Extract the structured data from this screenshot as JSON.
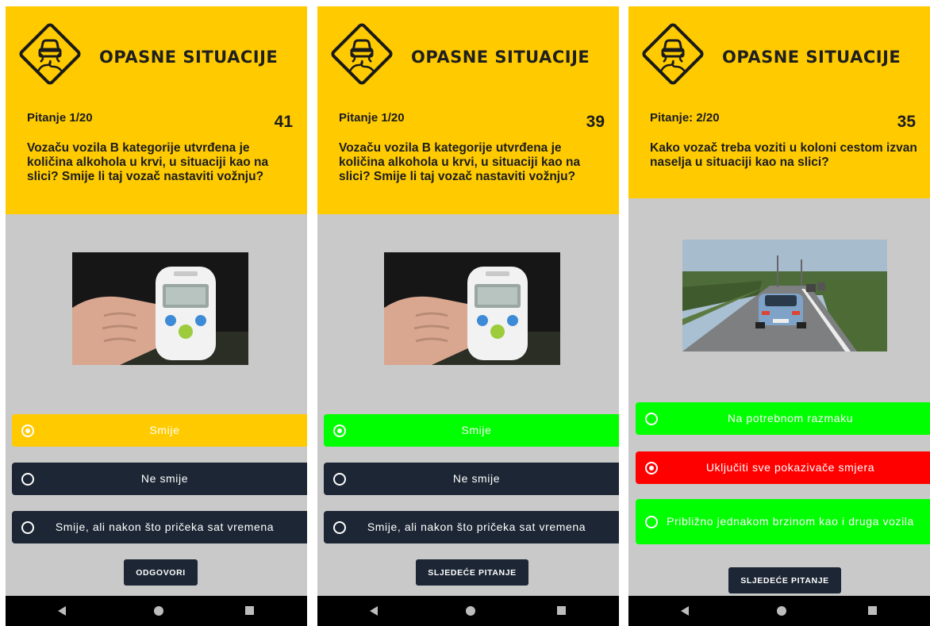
{
  "screens": [
    {
      "app_title": "OPASNE SITUACIJE",
      "question_counter": "Pitanje 1/20",
      "timer": "41",
      "question": "Vozaču vozila B kategorije utvrđena je količina alkohola u krvi, u situaciji kao na slici? Smije li taj vozač nastaviti vožnju?",
      "image_icon": "breathalyzer-photo",
      "answers": [
        {
          "label": "Smije",
          "state": "selected",
          "color": "#ffcb00"
        },
        {
          "label": "Ne smije",
          "state": "default",
          "color": "#1c2634"
        },
        {
          "label": "Smije, ali nakon što pričeka sat vremena",
          "state": "default",
          "color": "#1c2634"
        }
      ],
      "action_button": "ODGOVORI"
    },
    {
      "app_title": "OPASNE SITUACIJE",
      "question_counter": "Pitanje 1/20",
      "timer": "39",
      "question": "Vozaču vozila B kategorije utvrđena je količina alkohola u krvi, u situaciji kao na slici? Smije li taj vozač nastaviti vožnju?",
      "image_icon": "breathalyzer-photo",
      "answers": [
        {
          "label": "Smije",
          "state": "correct",
          "color": "#00ff00"
        },
        {
          "label": "Ne smije",
          "state": "default",
          "color": "#1c2634"
        },
        {
          "label": "Smije, ali nakon što pričeka sat vremena",
          "state": "default",
          "color": "#1c2634"
        }
      ],
      "action_button": "SLJEDEĆE PITANJE"
    },
    {
      "app_title": "OPASNE SITUACIJE",
      "question_counter": "Pitanje: 2/20",
      "timer": "35",
      "question": "Kako vozač treba voziti u koloni cestom izvan naselja u situaciji kao na slici?",
      "image_icon": "road-traffic-photo",
      "answers": [
        {
          "label": "Na potrebnom razmaku",
          "state": "correct",
          "color": "#00ff00"
        },
        {
          "label": "Uključiti sve pokazivače smjera",
          "state": "wrong",
          "color": "#ff0000"
        },
        {
          "label": "Približno jednakom brzinom kao i druga vozila",
          "state": "correct",
          "color": "#00ff00"
        }
      ],
      "action_button": "SLJEDEĆE PITANJE"
    }
  ],
  "colors": {
    "header": "#ffcb00",
    "background": "#c9c9c9",
    "dark_button": "#1c2634",
    "correct": "#00ff00",
    "wrong": "#ff0000"
  },
  "navbar": {
    "icons": [
      "back-icon",
      "home-icon",
      "recents-icon"
    ]
  }
}
